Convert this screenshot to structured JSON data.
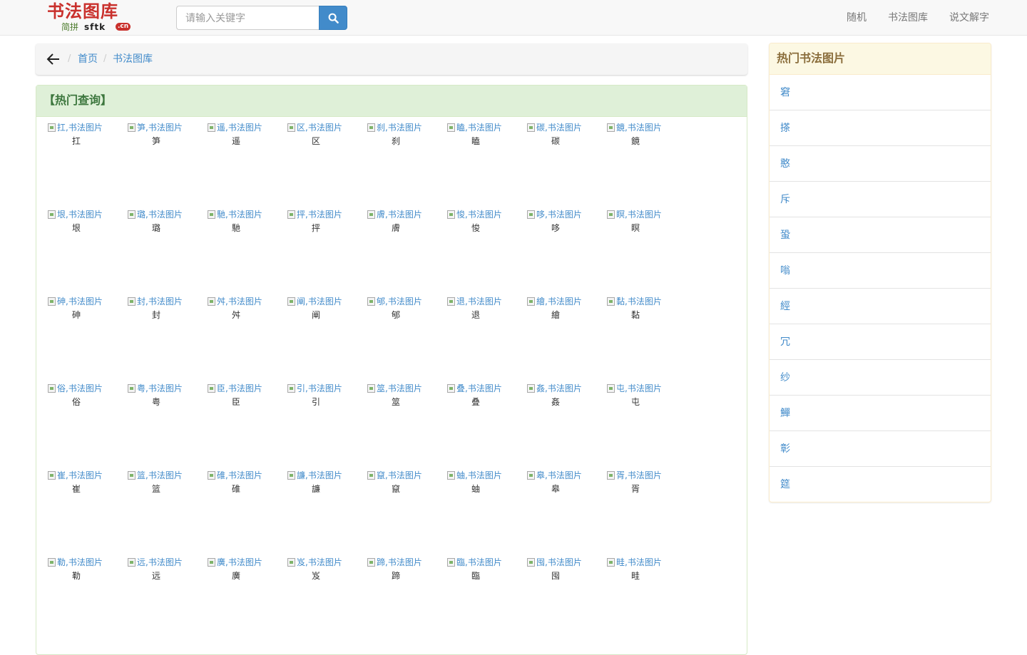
{
  "header": {
    "logo": {
      "title": "书法图库",
      "subtitle": "简拼",
      "domain": "sftk",
      "tld": ".cn"
    },
    "search": {
      "placeholder": "请输入关键字",
      "value": ""
    },
    "nav": [
      {
        "label": "随机"
      },
      {
        "label": "书法图库"
      },
      {
        "label": "说文解字"
      }
    ]
  },
  "breadcrumb": {
    "items": [
      {
        "label": "首页"
      },
      {
        "label": "书法图库"
      }
    ]
  },
  "main": {
    "title": "【热门查询】",
    "alt_suffix": ",书法图片",
    "chars": [
      "扛",
      "笋",
      "遥",
      "区",
      "刹",
      "瞌",
      "碳",
      "鏡",
      "垠",
      "璐",
      "馳",
      "抨",
      "膚",
      "悛",
      "哆",
      "瞑",
      "砷",
      "封",
      "舛",
      "阐",
      "郇",
      "退",
      "繪",
      "黏",
      "俗",
      "粤",
      "臣",
      "引",
      "筮",
      "叠",
      "姦",
      "屯",
      "崔",
      "篮",
      "碓",
      "譧",
      "竄",
      "蚰",
      "皋",
      "胥",
      "勒",
      "远",
      "廣",
      "岌",
      "蹄",
      "臨",
      "囤",
      "畦"
    ],
    "alts": [
      "扛,书法图片",
      "笋,书法图片",
      "遥,书法图片",
      "区,书法图片",
      "刹,书法图片",
      "瞌,书法图片",
      "碳,书法图片",
      "鏡,书法图片",
      "垠,书法图片",
      "璐,书法图片",
      "馳,书法图片",
      "抨,书法图片",
      "膚,书法图片",
      "悛,书法图片",
      "哆,书法图片",
      "瞑,书法图片",
      "砷,书法图片",
      "封,书法图片",
      "舛,书法图片",
      "阐,书法图片",
      "郇,书法图片",
      "退,书法图片",
      "繪,书法图片",
      "黏,书法图片",
      "俗,书法图片",
      "粤,书法图片",
      "臣,书法图片",
      "引,书法图片",
      "筮,书法图片",
      "叠,书法图片",
      "姦,书法图片",
      "屯,书法图片",
      "崔,书法图片",
      "篮,书法图片",
      "碓,书法图片",
      "譧,书法图片",
      "竄,书法图片",
      "蚰,书法图片",
      "皋,书法图片",
      "胥,书法图片",
      "勒,书法图片",
      "远,书法图片",
      "廣,书法图片",
      "岌,书法图片",
      "蹄,书法图片",
      "臨,书法图片",
      "囤,书法图片",
      "畦,书法图片"
    ]
  },
  "side": {
    "title": "热门书法图片",
    "items": [
      "窘",
      "搽",
      "憨",
      "斥",
      "蛩",
      "嗡",
      "經",
      "冗",
      "纱",
      "鱓",
      "彰",
      "筵"
    ]
  },
  "colors": {
    "link": "#428bca",
    "hot_heading_bg": "#dff0d8",
    "hot_heading_text": "#3c763d",
    "side_heading_bg": "#fcf8e3",
    "side_heading_text": "#8a6d3b",
    "logo_red": "#c9302c"
  }
}
